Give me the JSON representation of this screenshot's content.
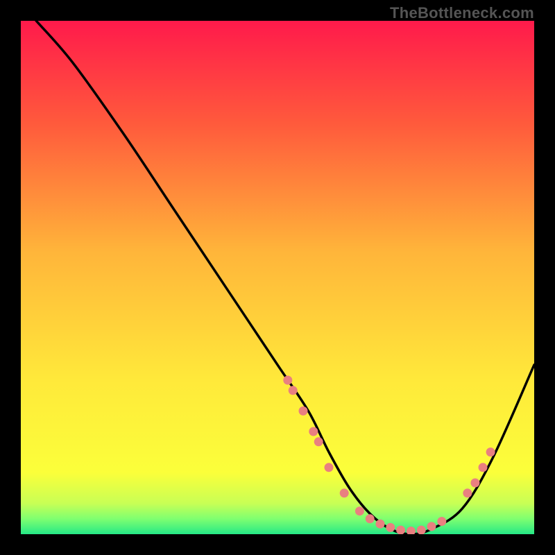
{
  "watermark": "TheBottleneck.com",
  "chart_data": {
    "type": "line",
    "title": "",
    "xlabel": "",
    "ylabel": "",
    "xlim": [
      0,
      100
    ],
    "ylim": [
      0,
      100
    ],
    "gradient_stops": [
      {
        "offset": 0,
        "color": "#ff1a4b"
      },
      {
        "offset": 20,
        "color": "#ff5a3c"
      },
      {
        "offset": 45,
        "color": "#ffb53a"
      },
      {
        "offset": 70,
        "color": "#ffe93a"
      },
      {
        "offset": 88,
        "color": "#fbff3a"
      },
      {
        "offset": 94,
        "color": "#c8ff55"
      },
      {
        "offset": 97,
        "color": "#7fff70"
      },
      {
        "offset": 100,
        "color": "#25e886"
      }
    ],
    "series": [
      {
        "name": "bottleneck-curve",
        "x": [
          3,
          10,
          20,
          30,
          40,
          50,
          56,
          60,
          64,
          68,
          72,
          76,
          80,
          86,
          92,
          100
        ],
        "y": [
          100,
          92,
          78,
          63,
          48,
          33,
          24,
          16,
          9,
          4,
          1,
          0,
          1,
          5,
          15,
          33
        ]
      }
    ],
    "markers": {
      "name": "highlight-points",
      "color": "#e98080",
      "points": [
        {
          "x": 52,
          "y": 30
        },
        {
          "x": 53,
          "y": 28
        },
        {
          "x": 55,
          "y": 24
        },
        {
          "x": 57,
          "y": 20
        },
        {
          "x": 58,
          "y": 18
        },
        {
          "x": 60,
          "y": 13
        },
        {
          "x": 63,
          "y": 8
        },
        {
          "x": 66,
          "y": 4.5
        },
        {
          "x": 68,
          "y": 3
        },
        {
          "x": 70,
          "y": 2
        },
        {
          "x": 72,
          "y": 1.3
        },
        {
          "x": 74,
          "y": 0.8
        },
        {
          "x": 76,
          "y": 0.6
        },
        {
          "x": 78,
          "y": 0.8
        },
        {
          "x": 80,
          "y": 1.5
        },
        {
          "x": 82,
          "y": 2.5
        },
        {
          "x": 87,
          "y": 8
        },
        {
          "x": 88.5,
          "y": 10
        },
        {
          "x": 90,
          "y": 13
        },
        {
          "x": 91.5,
          "y": 16
        }
      ]
    }
  }
}
